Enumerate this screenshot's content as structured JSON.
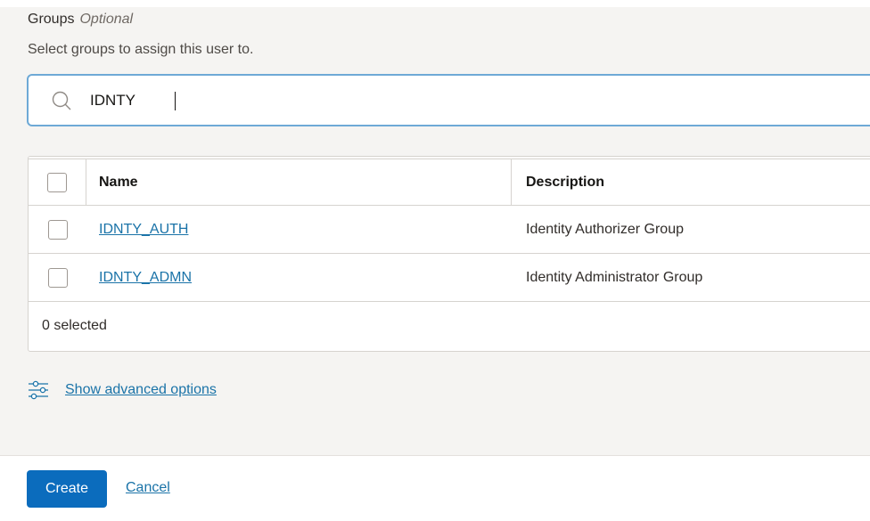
{
  "groups_section": {
    "label": "Groups",
    "optional": "Optional",
    "help": "Select groups to assign this user to."
  },
  "search": {
    "value": "IDNTY",
    "placeholder": "",
    "icon": "search-icon"
  },
  "table": {
    "headers": {
      "name": "Name",
      "description": "Description"
    },
    "rows": [
      {
        "name": "IDNTY_AUTH",
        "description": "Identity Authorizer Group",
        "checked": false
      },
      {
        "name": "IDNTY_ADMN",
        "description": "Identity Administrator Group",
        "checked": false
      }
    ],
    "selection_status": "0 selected"
  },
  "advanced": {
    "label": "Show advanced options",
    "icon": "sliders-icon"
  },
  "actions": {
    "create_label": "Create",
    "cancel_label": "Cancel"
  },
  "colors": {
    "primary": "#0b6cbd",
    "link": "#1a73a8",
    "focus_border": "#6ea9d6",
    "background": "#f5f4f2"
  }
}
